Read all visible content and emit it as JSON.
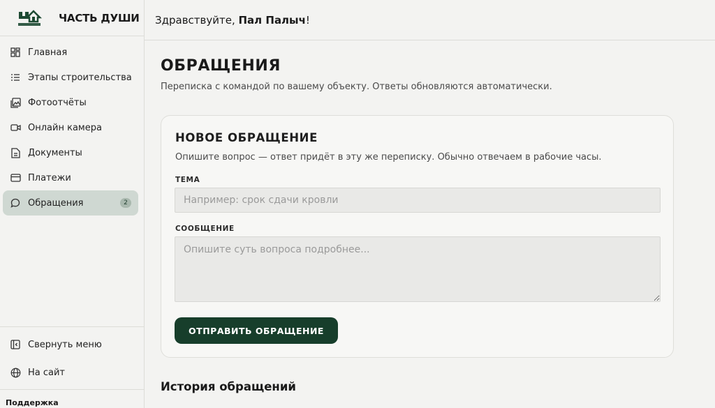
{
  "brand": {
    "name": "ЧАСТЬ ДУШИ",
    "logo_text": "ЧАСТЬ ДУШИ"
  },
  "header": {
    "greeting": "Здравствуйте, ",
    "user_name": "Пал Палыч",
    "exclaim": "!"
  },
  "sidebar": {
    "items": [
      {
        "label": "Главная",
        "icon": "dashboard-icon"
      },
      {
        "label": "Этапы строительства",
        "icon": "list-icon"
      },
      {
        "label": "Фотоотчёты",
        "icon": "photo-gallery-icon"
      },
      {
        "label": "Онлайн камера",
        "icon": "video-camera-icon"
      },
      {
        "label": "Документы",
        "icon": "document-icon"
      },
      {
        "label": "Платежи",
        "icon": "card-icon"
      },
      {
        "label": "Обращения",
        "icon": "chat-bubble-icon",
        "badge": "2",
        "active": true
      }
    ],
    "bottom": [
      {
        "label": "Свернуть меню",
        "icon": "collapse-menu-icon"
      },
      {
        "label": "На сайт",
        "icon": "globe-icon"
      }
    ],
    "support_title": "Поддержка"
  },
  "main": {
    "title": "ОБРАЩЕНИЯ",
    "subtitle": "Переписка с командой по вашему объекту. Ответы обновляются автоматически.",
    "form": {
      "title": "НОВОЕ ОБРАЩЕНИЕ",
      "subtitle": "Опишите вопрос — ответ придёт в эту же переписку. Обычно отвечаем в рабочие часы.",
      "subject_label": "ТЕМА",
      "subject_placeholder": "Например: срок сдачи кровли",
      "message_label": "СООБЩЕНИЕ",
      "message_placeholder": "Опишите суть вопроса подробнее...",
      "submit_label": "ОТПРАВИТЬ ОБРАЩЕНИЕ"
    },
    "history_title": "История обращений"
  },
  "colors": {
    "accent": "#173e2b",
    "active_nav": "#cfd8d2",
    "background": "#f3f3f1"
  }
}
